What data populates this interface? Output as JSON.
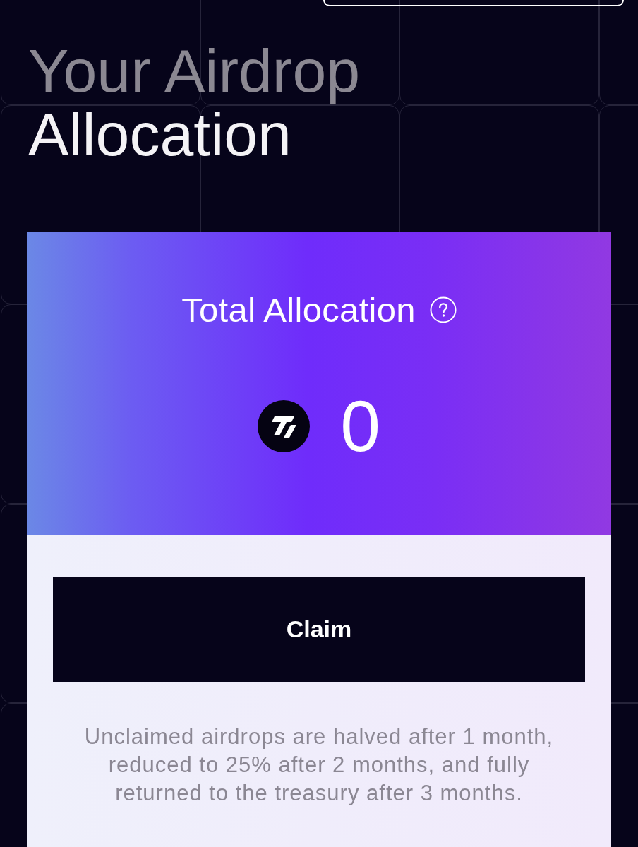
{
  "heading": {
    "muted": "Your Airdrop",
    "main": "Allocation"
  },
  "allocation_card": {
    "title": "Total Allocation",
    "amount": "0",
    "claim_button": "Claim",
    "note": "Unclaimed airdrops are halved after 1 month, reduced to 25% after 2 months, and fully returned to the treasury after 3 months."
  }
}
